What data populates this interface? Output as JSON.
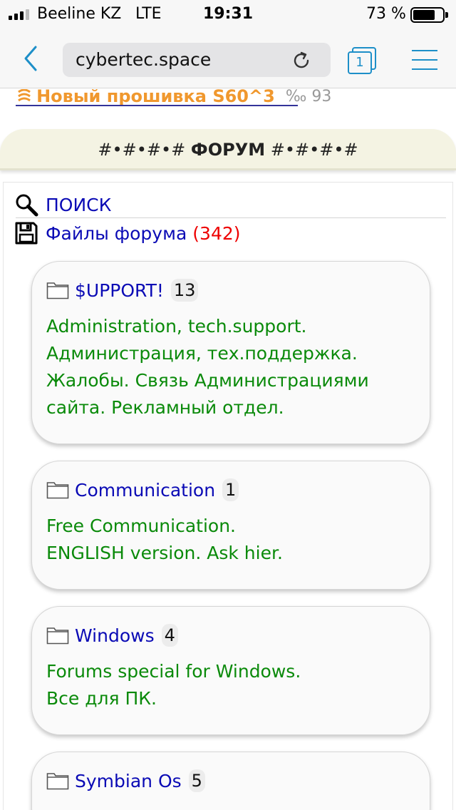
{
  "status_bar": {
    "carrier": "Beeline KZ",
    "network": "LTE",
    "time": "19:31",
    "battery_percent": "73 %",
    "battery_level": 0.73,
    "signal_bars": 3
  },
  "browser": {
    "url": "cybertec.space",
    "tab_count": "1"
  },
  "news": {
    "link_text": "Новый прошивка S60^3",
    "meta": "‰ 93"
  },
  "forum_header": {
    "prefix": "#•#•#•#",
    "title": "ФОРУМ",
    "suffix": "#•#•#•#"
  },
  "links": {
    "search_label": "ПОИСК",
    "files_label": "Файлы форума",
    "files_count": "(342)"
  },
  "forums": [
    {
      "name": "$UPPORT!",
      "count": "13",
      "description": "Administration, tech.support.\nАдминистрация, тех.поддержка.\nЖалобы. Связь Администрациями\nсайта. Рекламный отдел."
    },
    {
      "name": "Communication",
      "count": "1",
      "description": "Free Communication.\nENGLISH version. Ask hier."
    },
    {
      "name": "Windows",
      "count": "4",
      "description": "Forums special for Windows.\nВсе для ПК."
    },
    {
      "name": "Symbian Os",
      "count": "5",
      "description": ""
    }
  ],
  "colors": {
    "link": "#0a0ab5",
    "description": "#0a8a0a",
    "count": "#ee0000",
    "news": "#f0982e",
    "accent": "#1d8fc8"
  }
}
